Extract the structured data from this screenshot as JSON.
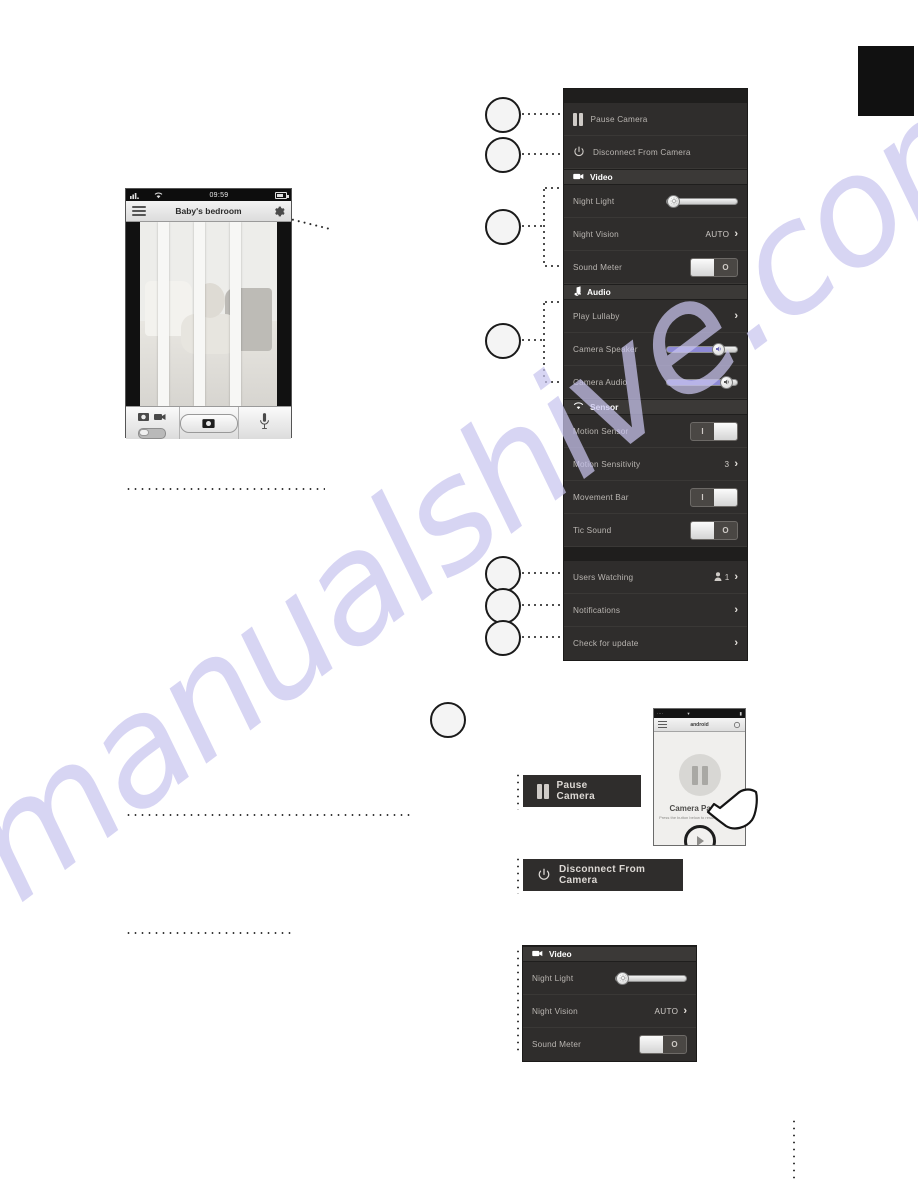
{
  "watermark": {
    "text": "manualshive.com"
  },
  "phone_live": {
    "status": {
      "time": "09:59",
      "signal_icon": "signal-bars-icon",
      "wifi_icon": "wifi-icon",
      "battery_icon": "battery-icon"
    },
    "nav": {
      "menu_icon": "hamburger-menu-icon",
      "title": "Baby's bedroom",
      "settings_icon": "gear-icon"
    },
    "toolbar": {
      "photo_icon": "photo-icon",
      "video_icon": "video-camera-icon",
      "mode_toggle_icon": "mode-toggle",
      "shutter_icon": "camera-shutter-icon",
      "mic_icon": "microphone-icon"
    }
  },
  "settings_panel": {
    "pause": {
      "label": "Pause Camera",
      "icon": "pause-icon"
    },
    "disconnect": {
      "label": "Disconnect From Camera",
      "icon": "power-icon"
    },
    "video_header": {
      "label": "Video",
      "icon": "video-camera-icon"
    },
    "night_light": {
      "label": "Night Light",
      "value_pct": 2,
      "knob_icon": "brightness-icon"
    },
    "night_vision": {
      "label": "Night Vision",
      "value": "AUTO",
      "chevron": "›"
    },
    "sound_meter": {
      "label": "Sound Meter",
      "state": "off",
      "off_mark": "O"
    },
    "audio_header": {
      "label": "Audio",
      "icon": "music-note-icon"
    },
    "play_lullaby": {
      "label": "Play Lullaby",
      "chevron": "›"
    },
    "camera_speaker": {
      "label": "Camera Speaker",
      "value_pct": 78,
      "knob_icon": "speaker-icon"
    },
    "camera_audio": {
      "label": "Camera Audio",
      "value_pct": 92,
      "knob_icon": "speaker-icon"
    },
    "sensor_header": {
      "label": "Sensor",
      "icon": "wifi-icon"
    },
    "motion_sensor": {
      "label": "Motion Sensor",
      "state": "on",
      "on_mark": "I"
    },
    "motion_sensitivity": {
      "label": "Motion Sensitivity",
      "value": "3",
      "chevron": "›"
    },
    "movement_bar": {
      "label": "Movement Bar",
      "state": "on",
      "on_mark": "I"
    },
    "tic_sound": {
      "label": "Tic Sound",
      "state": "off",
      "off_mark": "O"
    },
    "users_watching": {
      "label": "Users Watching",
      "count": "1",
      "icon": "person-icon",
      "chevron": "›"
    },
    "notifications": {
      "label": "Notifications",
      "chevron": "›"
    },
    "check_update": {
      "label": "Check for update",
      "chevron": "›"
    }
  },
  "callout_boxes": {
    "pause_camera": {
      "label": "Pause Camera",
      "icon": "pause-icon"
    },
    "disconnect_camera": {
      "label": "Disconnect From Camera",
      "icon": "power-icon"
    }
  },
  "video_card": {
    "header": {
      "label": "Video",
      "icon": "video-camera-icon"
    },
    "night_light": {
      "label": "Night Light",
      "value_pct": 2
    },
    "night_vision": {
      "label": "Night Vision",
      "value": "AUTO",
      "chevron": "›"
    },
    "sound_meter": {
      "label": "Sound Meter",
      "state": "off",
      "off_mark": "O"
    }
  },
  "phone_paused": {
    "nav": {
      "menu_icon": "hamburger-menu-icon",
      "title": "android",
      "settings_icon": "gear-icon"
    },
    "title": "Camera Paused",
    "subtitle": "Press the button below to\nresume the camera",
    "pause_icon": "pause-icon",
    "play_icon": "play-icon",
    "cursor_icon": "hand-pointer-icon"
  },
  "callout_numbers": {
    "n1": "",
    "n2": "",
    "n3": "",
    "n4": "",
    "n5": "",
    "n6": "",
    "n7": "",
    "n8": ""
  },
  "colors": {
    "panel_bg": "#2a2827",
    "row_bg": "#2f2d2c",
    "header_bg": "#3b3937",
    "text": "#cfcbc7",
    "slider_fill": "#8e8ad6",
    "watermark": "#c9c5ef"
  }
}
